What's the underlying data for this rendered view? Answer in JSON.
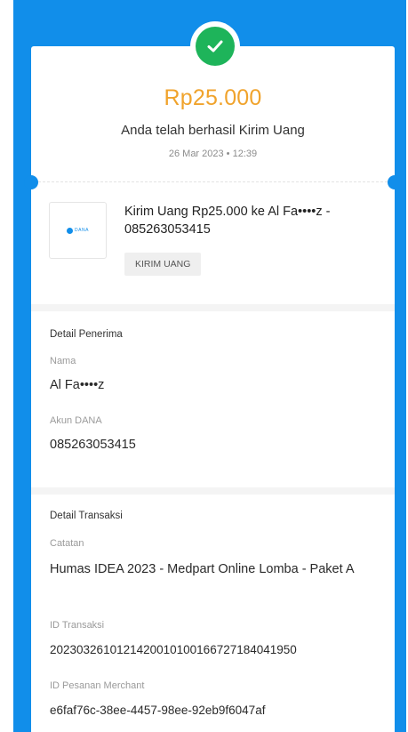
{
  "receipt": {
    "amount": "Rp25.000",
    "message": "Anda telah berhasil Kirim Uang",
    "datetime": "26 Mar 2023 • 12:39"
  },
  "transaction_summary": {
    "logo_text": "DANA",
    "title": "Kirim Uang Rp25.000 ke Al Fa••••z - 085263053415",
    "tag": "KIRIM UANG"
  },
  "recipient_details": {
    "section_title": "Detail Penerima",
    "name_label": "Nama",
    "name_value": "Al Fa••••z",
    "account_label": "Akun DANA",
    "account_value": "085263053415"
  },
  "transaction_details": {
    "section_title": "Detail Transaksi",
    "note_label": "Catatan",
    "note_value": "Humas IDEA 2023 - Medpart Online Lomba - Paket A",
    "transaction_id_label": "ID Transaksi",
    "transaction_id_value": "2023032610121420010100166727184041950",
    "merchant_order_id_label": "ID Pesanan Merchant",
    "merchant_order_id_value": "e6faf76c-38ee-4457-98ee-92eb9f6047af"
  },
  "colors": {
    "brand_blue": "#118EEA",
    "amount_orange": "#F0A32C",
    "success_green": "#1EB45A"
  },
  "icons": {
    "success": "check-circle-icon",
    "merchant": "dana-logo-icon"
  }
}
